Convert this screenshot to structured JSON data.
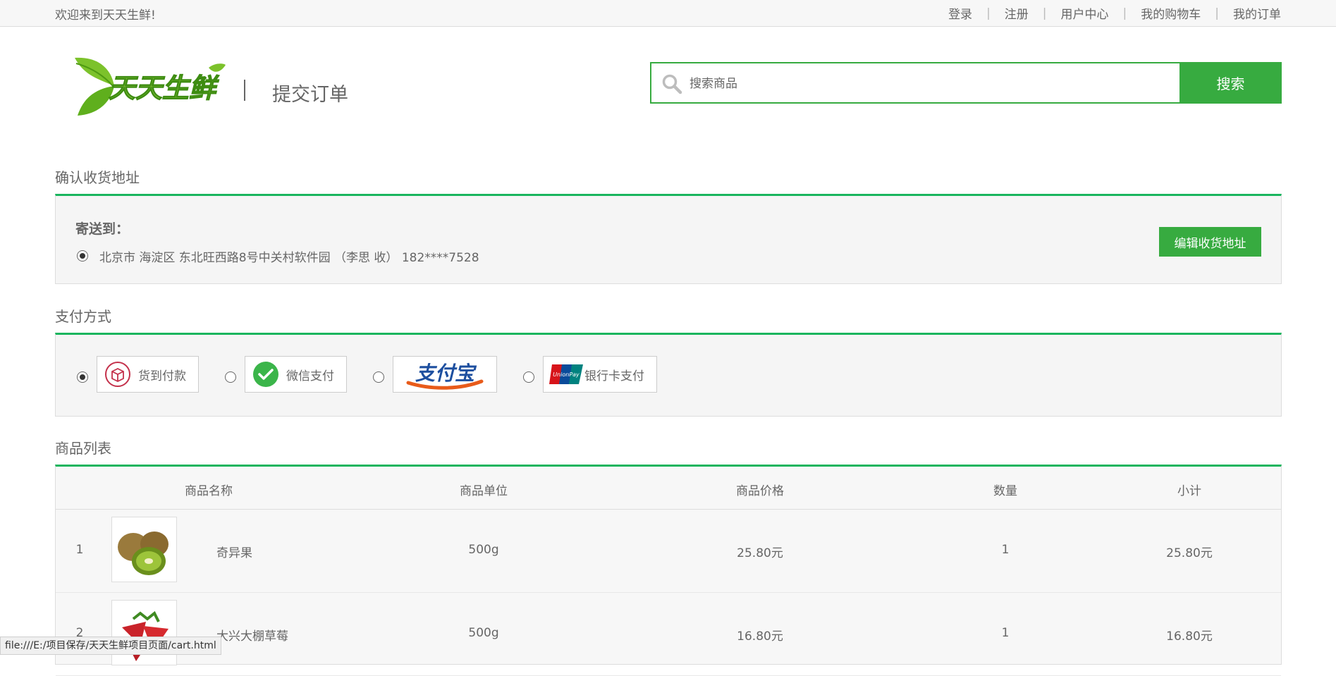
{
  "topbar": {
    "welcome": "欢迎来到天天生鲜!",
    "nav": [
      "登录",
      "注册",
      "用户中心",
      "我的购物车",
      "我的订单"
    ]
  },
  "header": {
    "logo_text": "天天生鲜",
    "page_title": "提交订单",
    "search_placeholder": "搜索商品",
    "search_button": "搜索"
  },
  "address": {
    "section_title": "确认收货地址",
    "label": "寄送到：",
    "entry": "北京市 海淀区 东北旺西路8号中关村软件园 （李思 收） 182****7528",
    "edit_button": "编辑收货地址"
  },
  "payment": {
    "section_title": "支付方式",
    "options": [
      {
        "label": "货到付款",
        "selected": true
      },
      {
        "label": "微信支付",
        "selected": false
      },
      {
        "label": "支付宝",
        "selected": false
      },
      {
        "label": "银行卡支付",
        "selected": false
      }
    ]
  },
  "goods": {
    "section_title": "商品列表",
    "columns": [
      "商品名称",
      "商品单位",
      "商品价格",
      "数量",
      "小计"
    ],
    "rows": [
      {
        "index": "1",
        "name": "奇异果",
        "unit": "500g",
        "price": "25.80元",
        "qty": "1",
        "subtotal": "25.80元"
      },
      {
        "index": "2",
        "name": "大兴大棚草莓",
        "unit": "500g",
        "price": "16.80元",
        "qty": "1",
        "subtotal": "16.80元"
      }
    ]
  },
  "statusbar": {
    "url": "file:///E:/项目保存/天天生鲜项目页面/cart.html"
  },
  "colors": {
    "accent_green": "#37ab40",
    "section_line": "#1ab55e"
  }
}
